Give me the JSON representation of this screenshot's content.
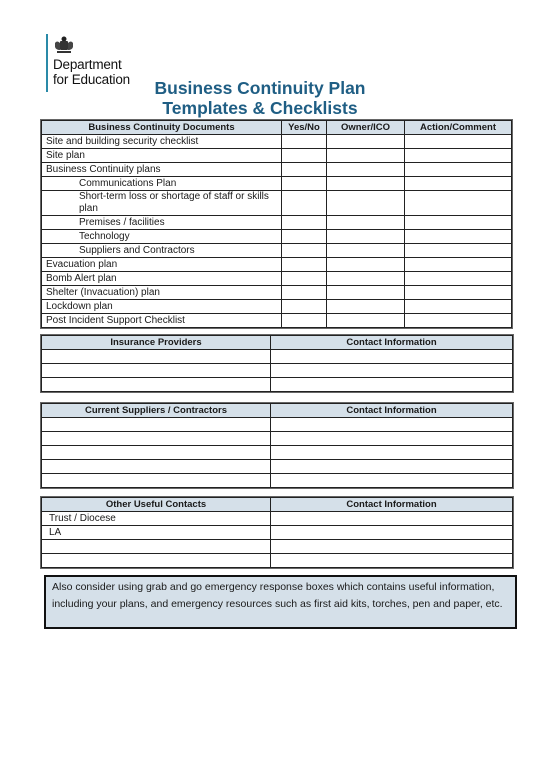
{
  "logo": {
    "line1": "Department",
    "line2": "for Education",
    "icon": "royal-coat-of-arms-icon",
    "accent_color": "#2a8aa8"
  },
  "title": {
    "line1": "Business Continuity Plan",
    "line2": "Templates & Checklists",
    "color": "#1f5e84"
  },
  "documents_table": {
    "headers": [
      "Business Continuity Documents",
      "Yes/No",
      "Owner/ICO",
      "Action/Comment"
    ],
    "rows": [
      {
        "label": "Site and building security checklist",
        "indent": false
      },
      {
        "label": "Site plan",
        "indent": false
      },
      {
        "label": "Business Continuity plans",
        "indent": false
      },
      {
        "label": "Communications Plan",
        "indent": true
      },
      {
        "label": "Short-term loss or shortage of staff or skills plan",
        "indent": true
      },
      {
        "label": "Premises / facilities",
        "indent": true
      },
      {
        "label": "Technology",
        "indent": true
      },
      {
        "label": "Suppliers and Contractors",
        "indent": true
      },
      {
        "label": "Evacuation plan",
        "indent": false
      },
      {
        "label": "Bomb Alert plan",
        "indent": false
      },
      {
        "label": "Shelter (Invacuation) plan",
        "indent": false
      },
      {
        "label": "Lockdown plan",
        "indent": false
      },
      {
        "label": "Post Incident Support Checklist",
        "indent": false
      }
    ]
  },
  "insurance_table": {
    "headers": [
      "Insurance Providers",
      "Contact Information"
    ],
    "rows": [
      "",
      "",
      ""
    ]
  },
  "suppliers_table": {
    "headers": [
      "Current Suppliers / Contractors",
      "Contact Information"
    ],
    "rows": [
      "",
      "",
      "",
      "",
      ""
    ]
  },
  "contacts_table": {
    "headers": [
      "Other Useful Contacts",
      "Contact Information"
    ],
    "rows": [
      "Trust / Diocese",
      "LA",
      "",
      ""
    ]
  },
  "note": {
    "text": "Also consider using grab and go emergency response boxes which contains useful information, including your plans, and emergency resources such as first aid kits, torches, pen and paper, etc.",
    "background": "#d5e0e9"
  },
  "header_fill": "#d5e0e9"
}
